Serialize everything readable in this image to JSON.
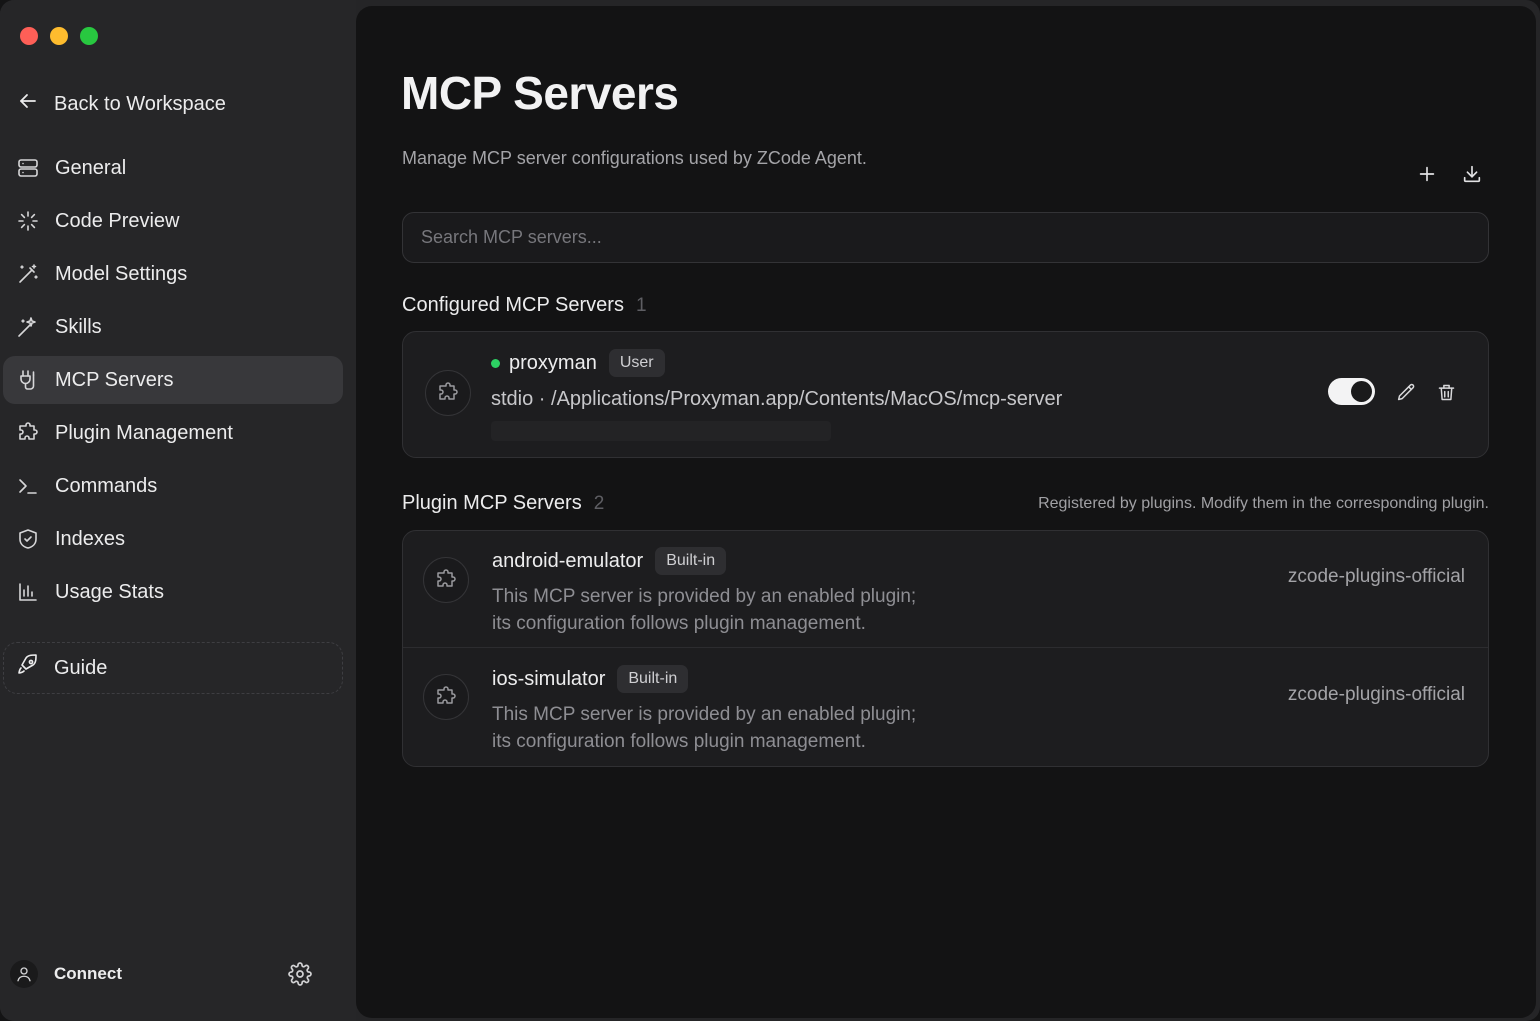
{
  "sidebar": {
    "back_label": "Back to Workspace",
    "items": [
      {
        "label": "General",
        "icon": "server-icon"
      },
      {
        "label": "Code Preview",
        "icon": "sparkle-icon"
      },
      {
        "label": "Model Settings",
        "icon": "magic-wand-icon"
      },
      {
        "label": "Skills",
        "icon": "wand-icon"
      },
      {
        "label": "MCP Servers",
        "icon": "plug-icon",
        "active": true
      },
      {
        "label": "Plugin Management",
        "icon": "puzzle-icon"
      },
      {
        "label": "Commands",
        "icon": "terminal-icon"
      },
      {
        "label": "Indexes",
        "icon": "shield-icon"
      },
      {
        "label": "Usage Stats",
        "icon": "bar-chart-icon"
      }
    ],
    "guide_label": "Guide",
    "footer": {
      "connect_label": "Connect"
    }
  },
  "main": {
    "title": "MCP Servers",
    "description": "Manage MCP server configurations used by ZCode Agent.",
    "search_placeholder": "Search MCP servers...",
    "configured": {
      "title": "Configured MCP Servers",
      "count": "1",
      "servers": [
        {
          "name": "proxyman",
          "badge": "User",
          "status_color": "#2dd163",
          "command": "stdio · /Applications/Proxyman.app/Contents/MacOS/mcp-server",
          "enabled": true
        }
      ]
    },
    "plugin": {
      "title": "Plugin MCP Servers",
      "count": "2",
      "note": "Registered by plugins. Modify them in the corresponding plugin.",
      "servers": [
        {
          "name": "android-emulator",
          "badge": "Built-in",
          "desc_line1": "This MCP server is provided by an enabled plugin;",
          "desc_line2": "its configuration follows plugin management.",
          "source": "zcode-plugins-official"
        },
        {
          "name": "ios-simulator",
          "badge": "Built-in",
          "desc_line1": "This MCP server is provided by an enabled plugin;",
          "desc_line2": "its configuration follows plugin management.",
          "source": "zcode-plugins-official"
        }
      ]
    }
  },
  "colors": {
    "accent_green": "#2dd163",
    "sidebar_bg": "#262628",
    "main_bg": "#131314"
  }
}
